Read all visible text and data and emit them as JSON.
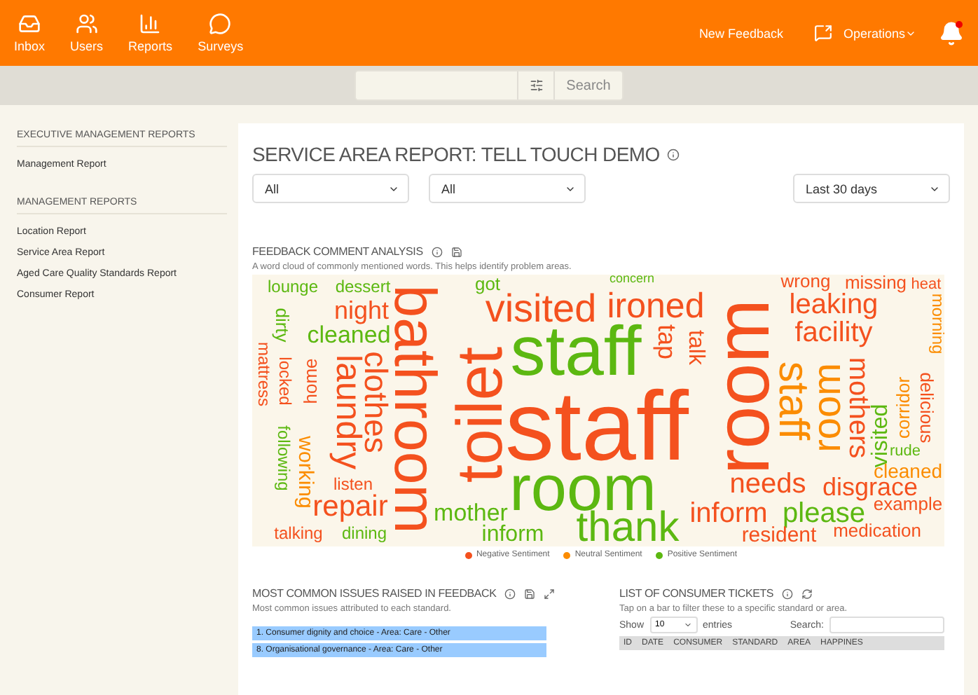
{
  "nav": {
    "items": [
      {
        "label": "Inbox",
        "kind": "inbox"
      },
      {
        "label": "Users",
        "kind": "users"
      },
      {
        "label": "Reports",
        "kind": "reports"
      },
      {
        "label": "Surveys",
        "kind": "surveys"
      }
    ],
    "new_feedback": "New Feedback",
    "operations": "Operations",
    "unread": true
  },
  "search": {
    "button": "Search"
  },
  "sidebar": {
    "sections": [
      {
        "heading": "EXECUTIVE MANAGEMENT REPORTS",
        "items": [
          "Management Report"
        ]
      },
      {
        "heading": "MANAGEMENT REPORTS",
        "items": [
          "Location Report",
          "Service Area Report",
          "Aged Care Quality Standards Report",
          "Consumer Report"
        ]
      }
    ]
  },
  "report": {
    "title": "SERVICE AREA REPORT: TELL TOUCH DEMO",
    "filters": [
      "All",
      "All"
    ],
    "date_range": "Last 30 days"
  },
  "word_cloud": {
    "title": "FEEDBACK COMMENT ANALYSIS",
    "description": "A word cloud of commonly mentioned words. This helps identify problem areas.",
    "words": [
      {
        "text": "lounge",
        "color": "#5cb811"
      },
      {
        "text": "dessert",
        "color": "#5cb811"
      },
      {
        "text": "got",
        "color": "#5cb811"
      },
      {
        "text": "concern",
        "color": "#5cb811"
      },
      {
        "text": "wrong",
        "color": "#f4511e"
      },
      {
        "text": "missing",
        "color": "#f4511e"
      },
      {
        "text": "heat",
        "color": "#f4511e"
      },
      {
        "text": "bathroom",
        "color": "#f4511e"
      },
      {
        "text": "night",
        "color": "#f4511e"
      },
      {
        "text": "visited",
        "color": "#f4511e"
      },
      {
        "text": "ironed",
        "color": "#f4511e"
      },
      {
        "text": "leaking",
        "color": "#f4511e"
      },
      {
        "text": "morning",
        "color": "#fb8c00"
      },
      {
        "text": "room",
        "color": "#f4511e"
      },
      {
        "text": "dirty",
        "color": "#5cb811"
      },
      {
        "text": "mattress",
        "color": "#f4511e"
      },
      {
        "text": "cleaned",
        "color": "#5cb811"
      },
      {
        "text": "staff",
        "color": "#5cb811"
      },
      {
        "text": "tap",
        "color": "#f4511e"
      },
      {
        "text": "talk",
        "color": "#f4511e"
      },
      {
        "text": "facility",
        "color": "#f4511e"
      },
      {
        "text": "toilet",
        "color": "#f4511e"
      },
      {
        "text": "laundry",
        "color": "#f4511e"
      },
      {
        "text": "clothes",
        "color": "#f4511e"
      },
      {
        "text": "locked",
        "color": "#f4511e"
      },
      {
        "text": "home",
        "color": "#f4511e"
      },
      {
        "text": "staff",
        "color": "#fb8c00"
      },
      {
        "text": "room",
        "color": "#fb8c00"
      },
      {
        "text": "mothers",
        "color": "#f4511e"
      },
      {
        "text": "corridor",
        "color": "#fb8c00"
      },
      {
        "text": "delicious",
        "color": "#f4511e"
      },
      {
        "text": "staff",
        "color": "#f4511e"
      },
      {
        "text": "visited",
        "color": "#5cb811"
      },
      {
        "text": "following",
        "color": "#5cb811"
      },
      {
        "text": "working",
        "color": "#fb8c00"
      },
      {
        "text": "rude",
        "color": "#5cb811"
      },
      {
        "text": "room",
        "color": "#5cb811"
      },
      {
        "text": "cleaned",
        "color": "#fb8c00"
      },
      {
        "text": "listen",
        "color": "#f4511e"
      },
      {
        "text": "needs",
        "color": "#f4511e"
      },
      {
        "text": "disgrace",
        "color": "#f4511e"
      },
      {
        "text": "repair",
        "color": "#f4511e"
      },
      {
        "text": "mother",
        "color": "#5cb811"
      },
      {
        "text": "inform",
        "color": "#f4511e"
      },
      {
        "text": "please",
        "color": "#5cb811"
      },
      {
        "text": "example",
        "color": "#f4511e"
      },
      {
        "text": "talking",
        "color": "#f4511e"
      },
      {
        "text": "dining",
        "color": "#5cb811"
      },
      {
        "text": "inform",
        "color": "#5cb811"
      },
      {
        "text": "thank",
        "color": "#5cb811"
      },
      {
        "text": "resident",
        "color": "#f4511e"
      },
      {
        "text": "medication",
        "color": "#f4511e"
      }
    ],
    "legend": [
      {
        "label": "Negative Sentiment",
        "color": "#f4511e"
      },
      {
        "label": "Neutral Sentiment",
        "color": "#fb8c00"
      },
      {
        "label": "Positive Sentiment",
        "color": "#5cb811"
      }
    ]
  },
  "issues": {
    "title": "MOST COMMON ISSUES RAISED IN FEEDBACK",
    "description": "Most common issues attributed to each standard.",
    "items": [
      "1. Consumer dignity and choice - Area: Care - Other",
      "8. Organisational governance - Area: Care - Other"
    ]
  },
  "tickets": {
    "title": "LIST OF CONSUMER TICKETS",
    "description": "Tap on a bar to filter these to a specific standard or area.",
    "show_label": "Show",
    "page_size": "10",
    "entries_label": "entries",
    "search_label": "Search:",
    "columns": [
      "ID",
      "DATE",
      "CONSUMER",
      "STANDARD",
      "AREA",
      "HAPPINES"
    ]
  }
}
